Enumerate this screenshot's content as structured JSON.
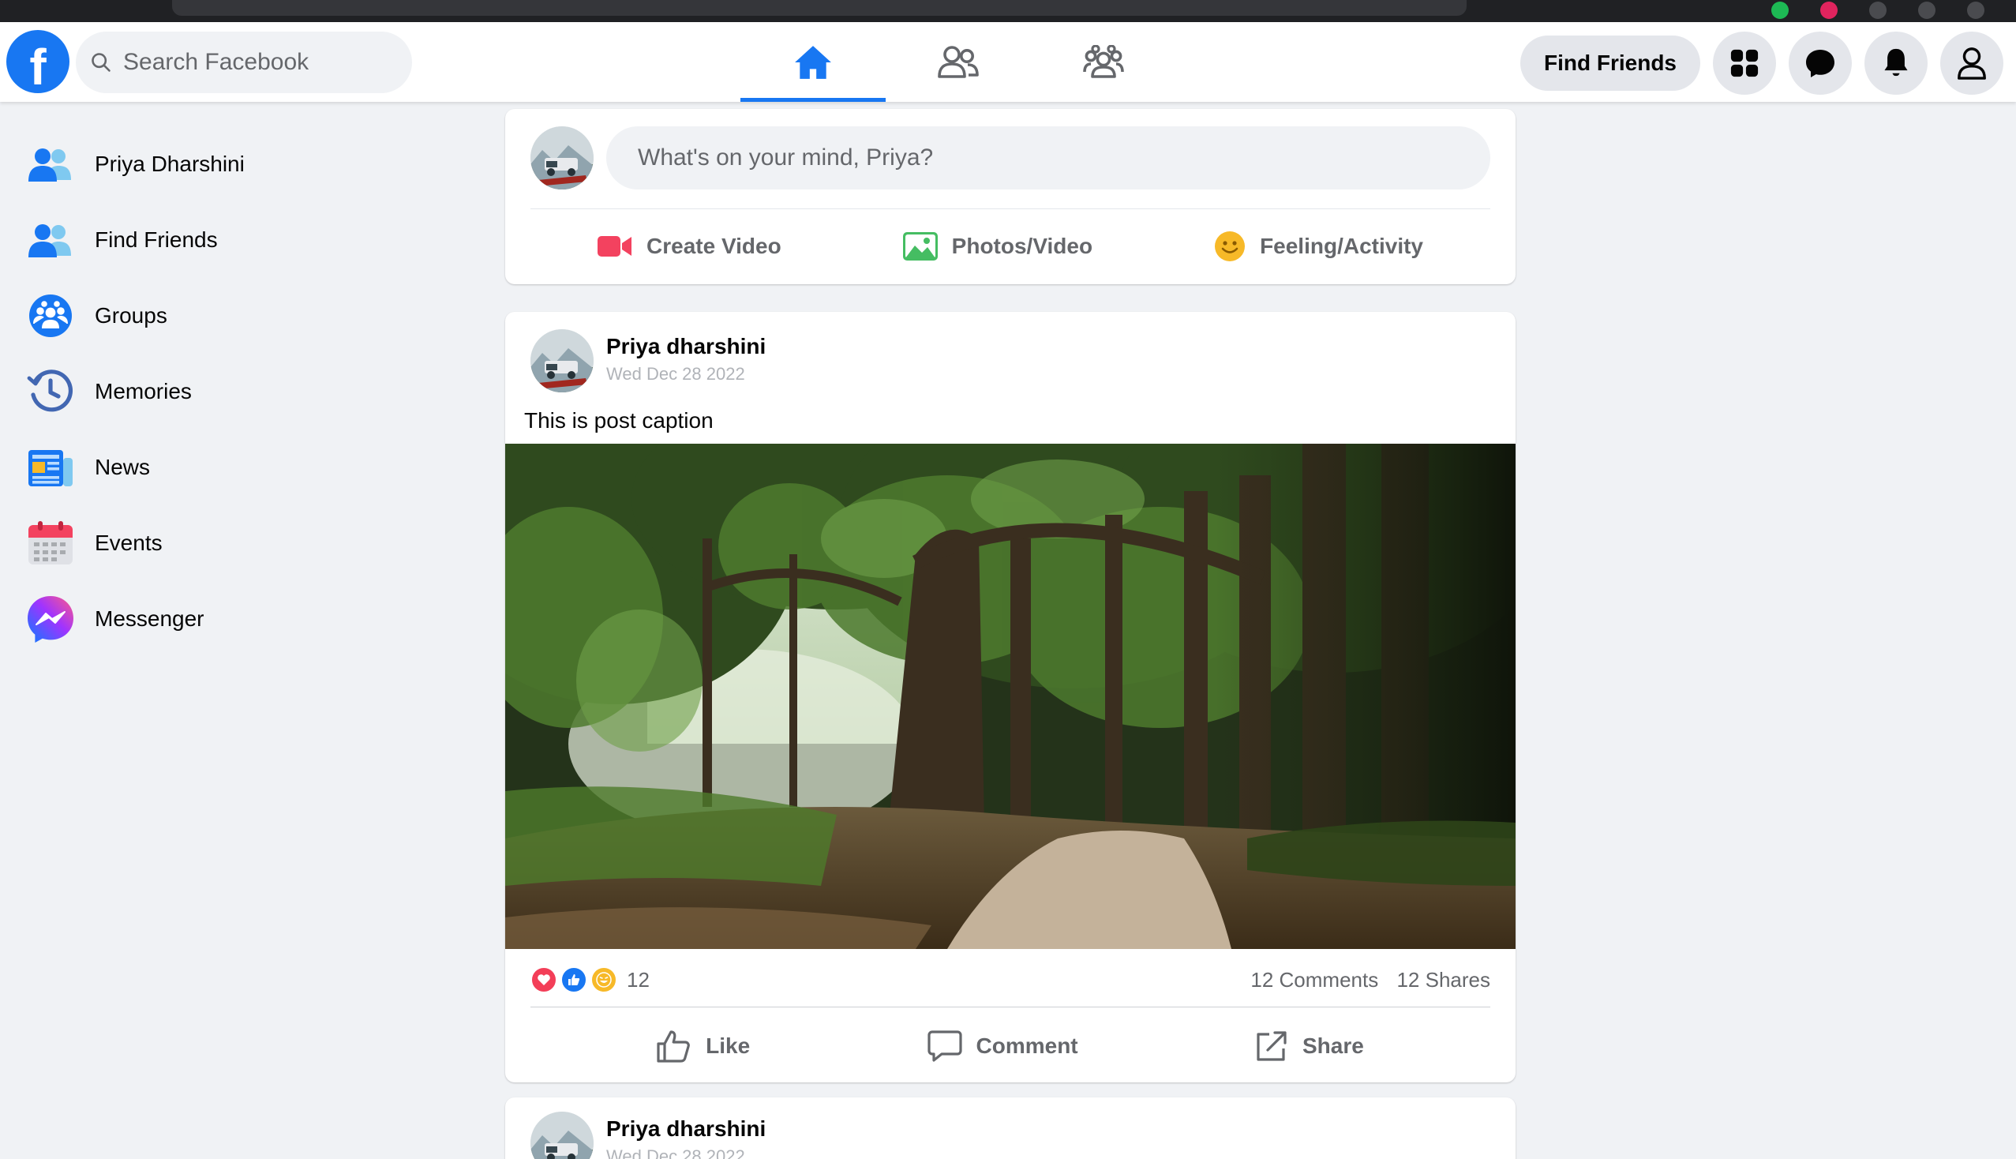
{
  "browser": {},
  "topnav": {
    "logo": "f",
    "search_placeholder": "Search Facebook",
    "tabs": [
      {
        "icon": "home-icon",
        "active": true
      },
      {
        "icon": "friends-icon",
        "active": false
      },
      {
        "icon": "groups-icon",
        "active": false
      }
    ],
    "find_friends_label": "Find Friends",
    "right_icons": [
      "menu-grid-icon",
      "messenger-icon",
      "notifications-bell-icon",
      "account-icon"
    ]
  },
  "sidebar": {
    "items": [
      {
        "label": "Priya Dharshini",
        "icon": "profile-icon"
      },
      {
        "label": "Find Friends",
        "icon": "friends-icon"
      },
      {
        "label": "Groups",
        "icon": "groups-icon"
      },
      {
        "label": "Memories",
        "icon": "memories-clock-icon"
      },
      {
        "label": "News",
        "icon": "news-icon"
      },
      {
        "label": "Events",
        "icon": "calendar-icon"
      },
      {
        "label": "Messenger",
        "icon": "messenger-icon"
      }
    ]
  },
  "composer": {
    "placeholder": "What's on your mind, Priya?",
    "actions": [
      {
        "label": "Create Video",
        "icon": "video-camera-icon",
        "color": "#f3425f"
      },
      {
        "label": "Photos/Video",
        "icon": "photo-icon",
        "color": "#45bd62"
      },
      {
        "label": "Feeling/Activity",
        "icon": "smiley-icon",
        "color": "#f7b928"
      }
    ]
  },
  "posts": [
    {
      "author": "Priya dharshini",
      "date": "Wed Dec 28 2022",
      "caption": "This is post caption",
      "reactions": [
        "heart-icon",
        "like-icon",
        "haha-icon"
      ],
      "reaction_count": "12",
      "comments": "12 Comments",
      "shares": "12 Shares",
      "actions": [
        {
          "label": "Like",
          "icon": "thumbs-up-icon"
        },
        {
          "label": "Comment",
          "icon": "comment-icon"
        },
        {
          "label": "Share",
          "icon": "share-icon"
        }
      ]
    },
    {
      "author": "Priya dharshini",
      "date": "Wed Dec 28 2022"
    }
  ],
  "colors": {
    "brand": "#1877f2",
    "background": "#f0f2f5",
    "text": "#050505",
    "muted": "#65676b"
  }
}
